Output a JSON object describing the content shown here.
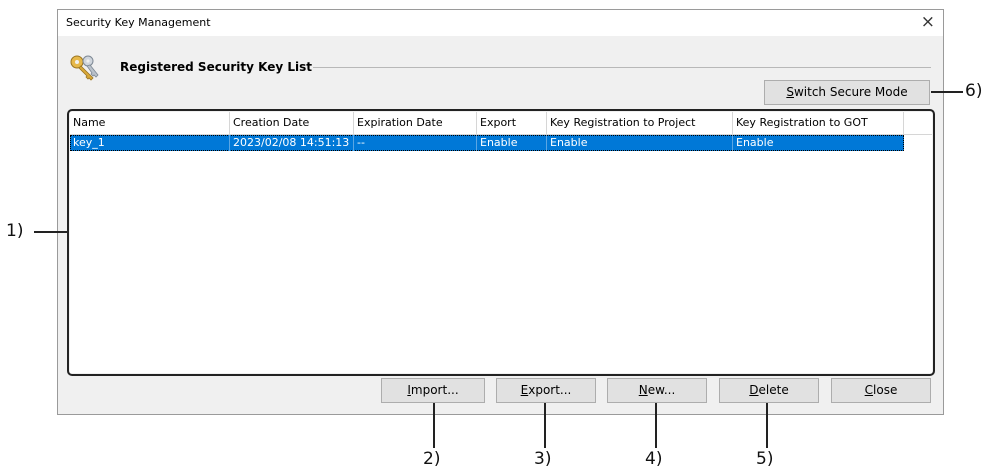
{
  "dialog": {
    "title": "Security Key Management",
    "close_glyph": "×",
    "section_title": "Registered Security Key List",
    "icon": "keys-icon"
  },
  "switch_button": {
    "pre": "",
    "mnemonic": "S",
    "post": "witch Secure Mode"
  },
  "table": {
    "columns": [
      "Name",
      "Creation Date",
      "Expiration Date",
      "Export",
      "Key Registration to Project",
      "Key Registration to GOT"
    ],
    "rows": [
      {
        "name": "key_1",
        "creation_date": "2023/02/08 14:51:13",
        "expiration_date": "--",
        "export": "Enable",
        "key_reg_project": "Enable",
        "key_reg_got": "Enable"
      }
    ]
  },
  "buttons": {
    "import": {
      "pre": "",
      "mnemonic": "I",
      "post": "mport..."
    },
    "export": {
      "pre": "",
      "mnemonic": "E",
      "post": "xport..."
    },
    "new": {
      "pre": "",
      "mnemonic": "N",
      "post": "ew..."
    },
    "delete": {
      "pre": "",
      "mnemonic": "D",
      "post": "elete"
    },
    "close": {
      "pre": "",
      "mnemonic": "C",
      "post": "lose"
    }
  },
  "callouts": [
    "1)",
    "2)",
    "3)",
    "4)",
    "5)",
    "6)"
  ]
}
